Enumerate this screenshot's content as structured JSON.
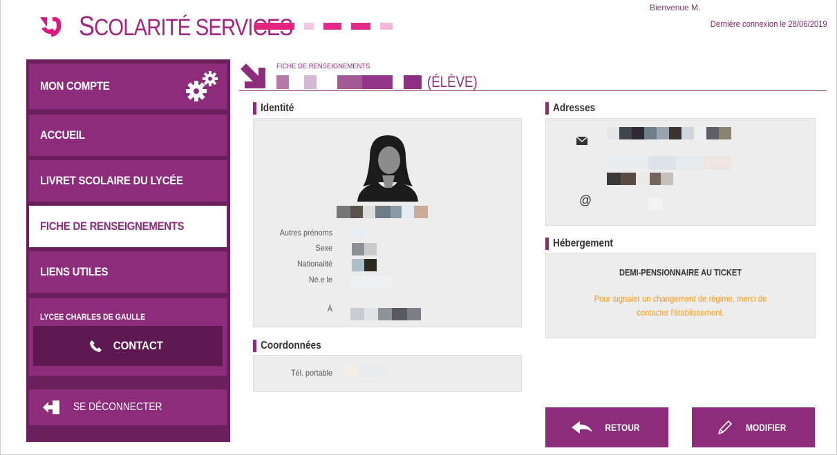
{
  "header": {
    "app_name_first": "S",
    "app_name_rest": "COLARITÉ SERVICES",
    "welcome": "Bienvenue M.",
    "last_login": "Dernière connexion le 28/06/2019"
  },
  "sidebar": {
    "items": [
      {
        "label": "MON COMPTE",
        "icon": "gears-icon"
      },
      {
        "label": "ACCUEIL"
      },
      {
        "label": "LIVRET SCOLAIRE DU LYCÉE"
      },
      {
        "label": "FICHE DE RENSEIGNEMENTS",
        "active": true
      },
      {
        "label": "LIENS UTILES"
      }
    ],
    "school_name": "LYCEE CHARLES DE GAULLE",
    "contact_label": "CONTACT",
    "logout_label": "SE DÉCONNECTER"
  },
  "page": {
    "small_title": "FICHE DE RENSEIGNEMENTS",
    "role_suffix": "(ÉLÈVE)"
  },
  "identite": {
    "title": "Identité",
    "labels": {
      "autres_prenoms": "Autres prénoms",
      "sexe": "Sexe",
      "nationalite": "Nationalité",
      "ne_le": "Né.e le",
      "a": "À"
    }
  },
  "coordonnees": {
    "title": "Coordonnées",
    "tel_label": "Tél. portable"
  },
  "adresses": {
    "title": "Adresses",
    "at_symbol": "@"
  },
  "hebergement": {
    "title": "Hébergement",
    "regime": "DEMI-PENSIONNAIRE AU TICKET",
    "message": "Pour signaler un changement de régime, merci de contacter l'établissement."
  },
  "actions": {
    "retour_label": "RETOUR",
    "modifier_label": "MODIFIER"
  },
  "colors": {
    "brand": "#8d2c7a",
    "brand_dark": "#6b1f5c",
    "accent_logo": "#e0187e",
    "warning_text": "#f0a020"
  }
}
